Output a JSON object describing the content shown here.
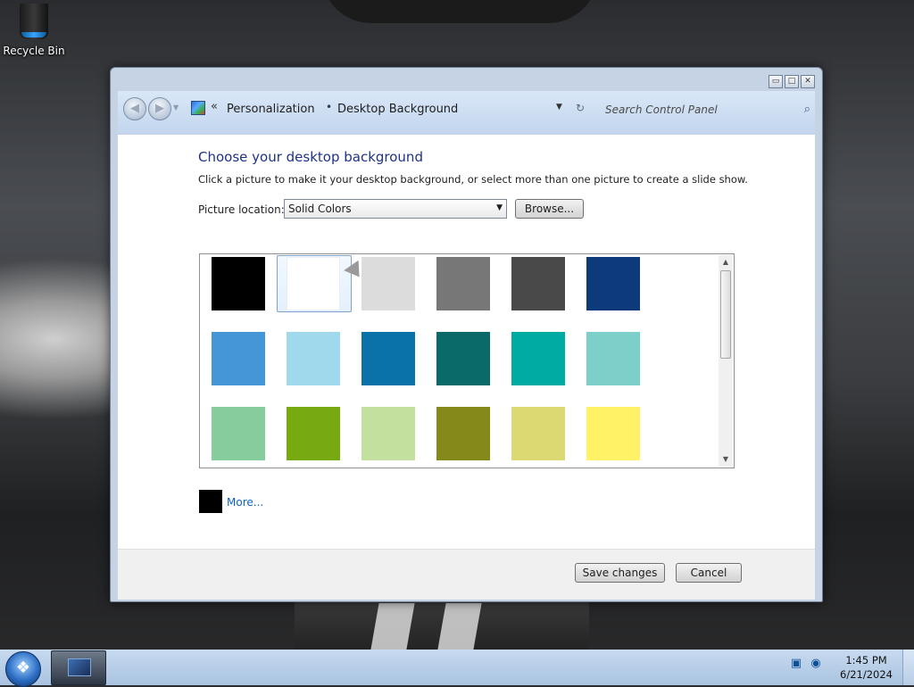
{
  "desktop": {
    "icons": [
      {
        "label": "Recycle Bin",
        "icon": "recycle-bin-icon"
      }
    ]
  },
  "window": {
    "caption_buttons": {
      "minimize": "▭",
      "maximize": "□",
      "close": "✕"
    },
    "nav": {
      "back_icon": "back-arrow-icon",
      "forward_icon": "forward-arrow-icon",
      "chevron": "«",
      "breadcrumb": [
        "Personalization",
        "Desktop Background"
      ],
      "separator": "•",
      "dropdown_glyph": "▼",
      "refresh_glyph": "↻"
    },
    "search": {
      "placeholder": "Search Control Panel",
      "icon": "search-icon"
    },
    "page": {
      "title": "Choose your desktop background",
      "description": "Click a picture to make it your desktop background, or select more than one picture to create a slide show.",
      "location_label": "Picture location:",
      "location_value": "Solid Colors",
      "browse_label": "Browse...",
      "swatches": [
        "#000000",
        "#ffffff",
        "#dcdcdc",
        "#777777",
        "#494949",
        "#0c3a7a",
        "#4596d6",
        "#a1d9ec",
        "#0a72a8",
        "#0a6a6a",
        "#00aba3",
        "#7dd0c9",
        "#86cd9e",
        "#76aa10",
        "#c3e09e",
        "#84891a",
        "#dcd872",
        "#fff266"
      ],
      "selected_index": 1,
      "more_label": "More...",
      "more_color": "#000000"
    },
    "footer": {
      "save_label": "Save changes",
      "cancel_label": "Cancel"
    }
  },
  "taskbar": {
    "clock_time": "1:45 PM",
    "clock_date": "6/21/2024",
    "tray_icons": [
      "network-icon",
      "volume-icon"
    ]
  },
  "colors": {
    "accent_title": "#1e3287",
    "link": "#0b63c4",
    "taskbar": "#bcd2ec"
  }
}
